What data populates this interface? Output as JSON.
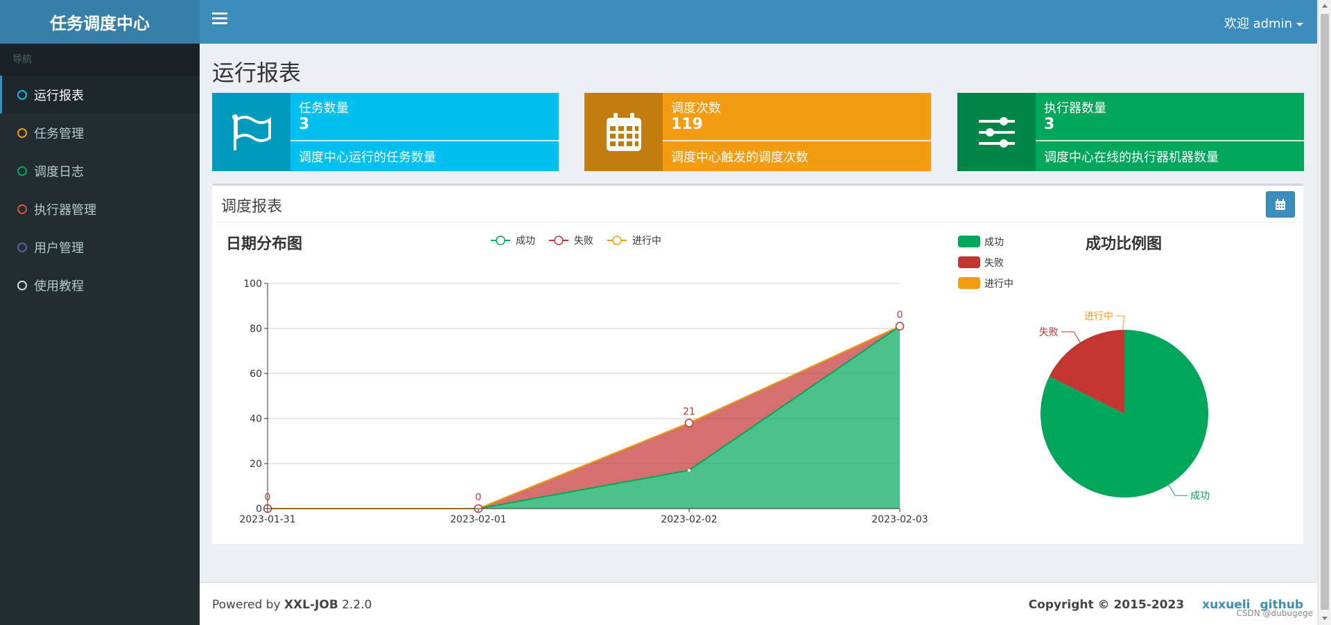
{
  "app": {
    "title": "任务调度中心"
  },
  "header": {
    "user_greeting": "欢迎 admin"
  },
  "sidebar": {
    "header": "导航",
    "items": [
      {
        "label": "运行报表",
        "color": "#00c0ef"
      },
      {
        "label": "任务管理",
        "color": "#f39c12"
      },
      {
        "label": "调度日志",
        "color": "#00a65a"
      },
      {
        "label": "执行器管理",
        "color": "#dd4b39"
      },
      {
        "label": "用户管理",
        "color": "#605ca8"
      },
      {
        "label": "使用教程",
        "color": "#d2d6de"
      }
    ]
  },
  "page": {
    "title": "运行报表"
  },
  "info_boxes": [
    {
      "label": "任务数量",
      "value": "3",
      "desc": "调度中心运行的任务数量",
      "icon": "flag-icon",
      "color": "#00c0ef"
    },
    {
      "label": "调度次数",
      "value": "119",
      "desc": "调度中心触发的调度次数",
      "icon": "calendar-icon",
      "color": "#f39c12"
    },
    {
      "label": "执行器数量",
      "value": "3",
      "desc": "调度中心在线的执行器机器数量",
      "icon": "sliders-icon",
      "color": "#00a65a"
    }
  ],
  "report": {
    "title": "调度报表",
    "line_chart_title": "日期分布图",
    "pie_chart_title": "成功比例图"
  },
  "chart_data": [
    {
      "type": "area",
      "title": "日期分布图",
      "x": [
        "2023-01-31",
        "2023-02-01",
        "2023-02-02",
        "2023-02-03"
      ],
      "ylim": [
        0,
        100
      ],
      "yticks": [
        0,
        20,
        40,
        60,
        80,
        100
      ],
      "stacked": true,
      "grid": true,
      "legend": "top",
      "series": [
        {
          "name": "成功",
          "values": [
            0,
            0,
            17,
            81
          ],
          "color": "#00a65a"
        },
        {
          "name": "失败",
          "values": [
            0,
            0,
            21,
            0
          ],
          "color": "#c23531"
        },
        {
          "name": "进行中",
          "values": [
            0,
            0,
            0,
            0
          ],
          "color": "#f39c12"
        }
      ],
      "data_labels": [
        "0",
        "0",
        "21",
        "0"
      ]
    },
    {
      "type": "pie",
      "title": "成功比例图",
      "legend": "top-left",
      "slices": [
        {
          "name": "成功",
          "value": 98,
          "color": "#00a65a"
        },
        {
          "name": "失败",
          "value": 21,
          "color": "#c23531"
        },
        {
          "name": "进行中",
          "value": 0,
          "color": "#f39c12"
        }
      ]
    }
  ],
  "footer": {
    "powered_prefix": "Powered by",
    "powered_name": "XXL-JOB",
    "version": "2.2.0",
    "copyright": "Copyright © 2015-2023",
    "link1": "xuxueli",
    "link2": "github"
  },
  "watermark": "CSDN @dubugege"
}
